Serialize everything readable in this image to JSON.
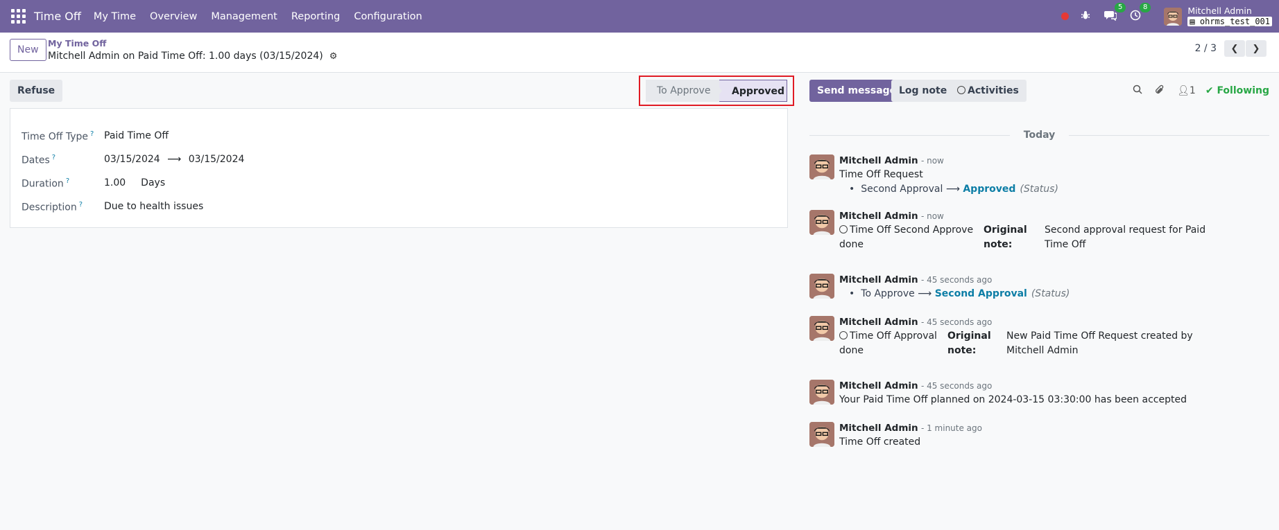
{
  "navbar": {
    "app_name": "Time Off",
    "menu": [
      "My Time",
      "Overview",
      "Management",
      "Reporting",
      "Configuration"
    ],
    "messages_badge": "5",
    "activities_badge": "8",
    "user_name": "Mitchell Admin",
    "database": "ohrms_test_001"
  },
  "control_panel": {
    "new_label": "New",
    "breadcrumb": "My Time Off",
    "record_title": "Mitchell Admin on Paid Time Off: 1.00 days (03/15/2024)",
    "pager": "2 / 3"
  },
  "form": {
    "refuse_label": "Refuse",
    "stages": [
      "To Approve",
      "Approved"
    ],
    "active_stage": "Approved",
    "fields": {
      "type_label": "Time Off Type",
      "type_value": "Paid Time Off",
      "dates_label": "Dates",
      "date_from": "03/15/2024",
      "date_to": "03/15/2024",
      "duration_label": "Duration",
      "duration_value": "1.00",
      "duration_unit": "Days",
      "description_label": "Description",
      "description_value": "Due to health issues"
    }
  },
  "chatter": {
    "send_message": "Send message",
    "log_note": "Log note",
    "activities": "Activities",
    "followers_count": "1",
    "following": "Following",
    "today": "Today",
    "messages": [
      {
        "author": "Mitchell Admin",
        "date": "- now",
        "text": "Time Off Request",
        "track_old": "Second Approval",
        "track_new": "Approved",
        "track_field": "(Status)"
      },
      {
        "author": "Mitchell Admin",
        "date": "- now",
        "activity": "Time Off Second Approve done",
        "note_label": "Original note:",
        "note": "Second approval request for Paid Time Off"
      },
      {
        "author": "Mitchell Admin",
        "date": "- 45 seconds ago",
        "track_old": "To Approve",
        "track_new": "Second Approval",
        "track_field": "(Status)"
      },
      {
        "author": "Mitchell Admin",
        "date": "- 45 seconds ago",
        "activity": "Time Off Approval done",
        "note_label": "Original note:",
        "note": "New Paid Time Off Request created by Mitchell Admin"
      },
      {
        "author": "Mitchell Admin",
        "date": "- 45 seconds ago",
        "text": "Your Paid Time Off planned on 2024-03-15 03:30:00 has been accepted"
      },
      {
        "author": "Mitchell Admin",
        "date": "- 1 minute ago",
        "text": "Time Off created"
      }
    ]
  },
  "colors": {
    "brand": "#71639e",
    "following": "#28a745",
    "highlight": "#e01b24",
    "link": "#0d7ea6"
  }
}
